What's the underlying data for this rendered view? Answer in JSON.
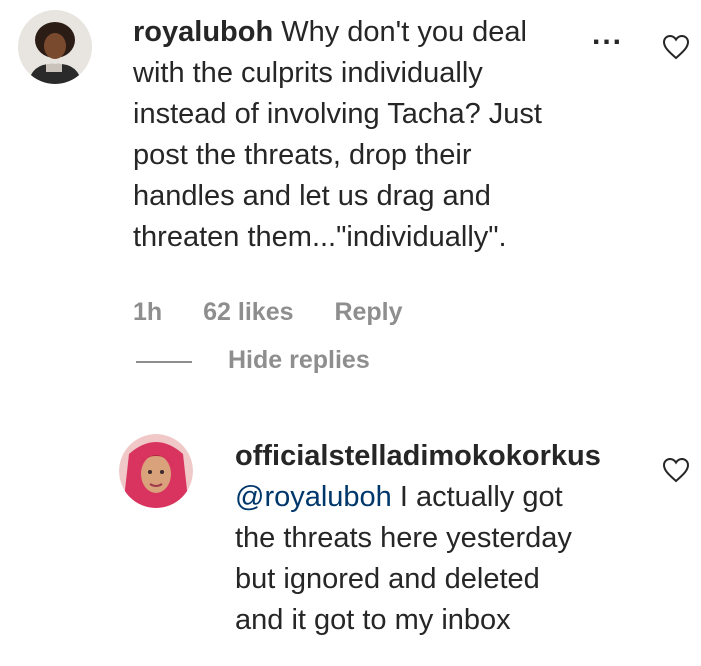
{
  "comment": {
    "username": "royaluboh",
    "text_first": "Why don't you deal",
    "text_lines": [
      "with the culprits individually",
      "instead of involving Tacha? Just",
      "post the threats, drop their",
      "handles and let us drag and",
      "threaten them...\"individually\"."
    ],
    "time": "1h",
    "likes": "62 likes",
    "reply_label": "Reply",
    "more_label": "...",
    "like_icon": "heart-outline-icon"
  },
  "replies_toggle": {
    "label": "Hide replies"
  },
  "reply": {
    "username": "officialstelladimokokorkus",
    "mention": "@royaluboh",
    "text_first": " I actually got",
    "text_lines": [
      "the threats here yesterday",
      "but ignored and deleted",
      "and it got to my inbox"
    ],
    "like_icon": "heart-outline-icon"
  }
}
